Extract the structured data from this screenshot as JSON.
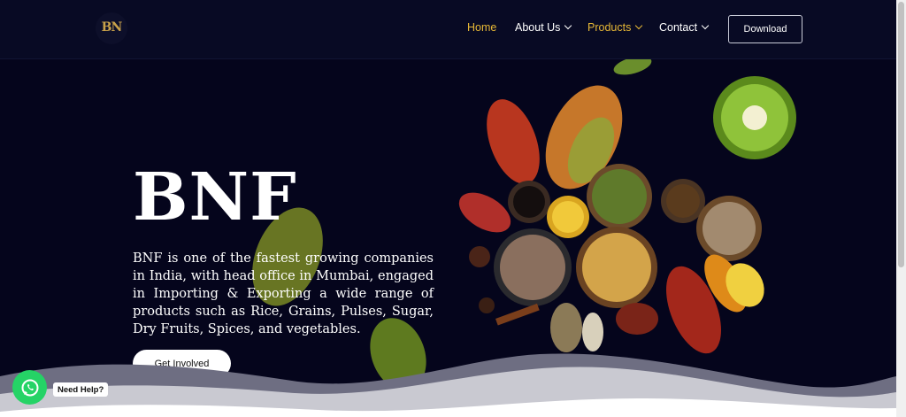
{
  "brand": {
    "logo_text": "BN"
  },
  "nav": {
    "items": [
      {
        "label": "Home",
        "active": true,
        "dropdown": false
      },
      {
        "label": "About Us",
        "active": false,
        "dropdown": true
      },
      {
        "label": "Products",
        "active": true,
        "dropdown": true
      },
      {
        "label": "Contact",
        "active": false,
        "dropdown": true
      }
    ],
    "download_label": "Download"
  },
  "hero": {
    "title": "BNF",
    "description": "BNF is one of the fastest growing companies in India, with head office in Mumbai, engaged in Importing & Exporting a wide range of products such as Rice, Grains, Pulses, Sugar, Dry Fruits, Spices, and vegetables.",
    "cta_label": "Get Involved"
  },
  "whatsapp": {
    "label": "Need Help?"
  },
  "colors": {
    "background": "#05051c",
    "header": "#080a24",
    "accent": "#e7b836",
    "whatsapp": "#25d366"
  },
  "icons": [
    "logo-icon",
    "chevron-down-icon",
    "whatsapp-icon"
  ]
}
